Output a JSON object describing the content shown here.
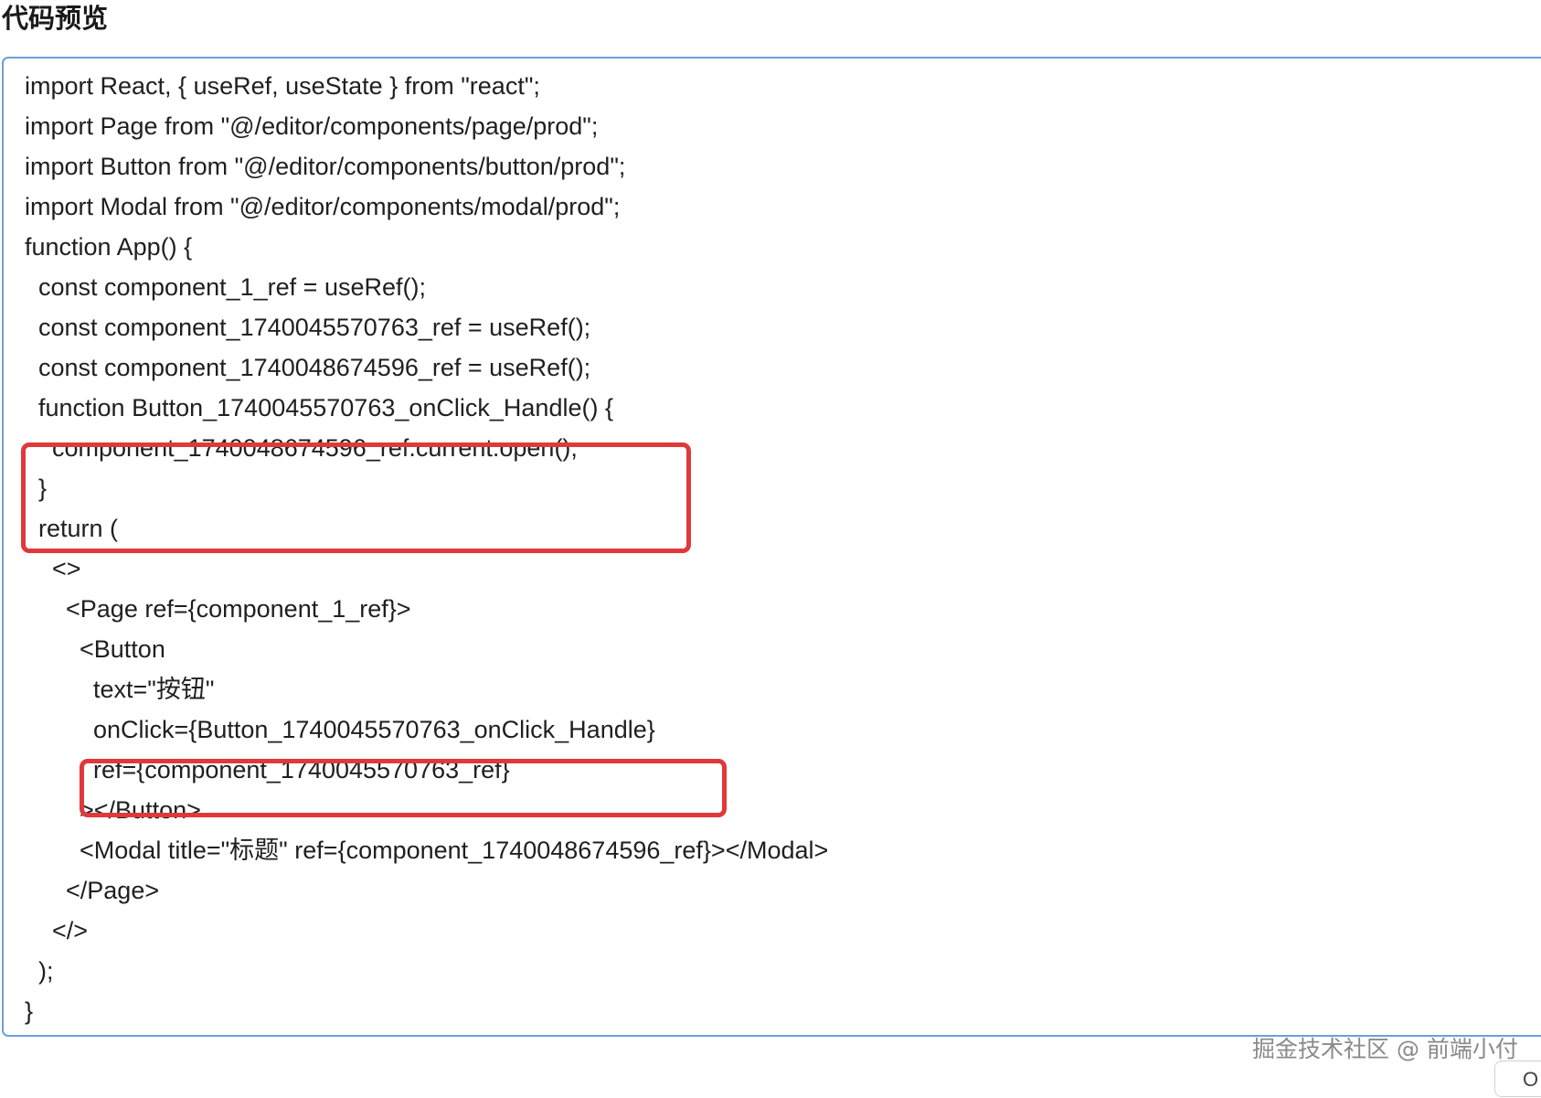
{
  "header": {
    "title": "代码预览"
  },
  "code_preview": {
    "lines": [
      "import React, { useRef, useState } from \"react\";",
      "import Page from \"@/editor/components/page/prod\";",
      "import Button from \"@/editor/components/button/prod\";",
      "import Modal from \"@/editor/components/modal/prod\";",
      "function App() {",
      "  const component_1_ref = useRef();",
      "  const component_1740045570763_ref = useRef();",
      "  const component_1740048674596_ref = useRef();",
      "  function Button_1740045570763_onClick_Handle() {",
      "    component_1740048674596_ref.current.open();",
      "  }",
      "  return (",
      "    <>",
      "      <Page ref={component_1_ref}>",
      "        <Button",
      "          text=\"按钮\"",
      "          onClick={Button_1740045570763_onClick_Handle}",
      "          ref={component_1740045570763_ref}",
      "        ></Button>",
      "        <Modal title=\"标题\" ref={component_1740048674596_ref}></Modal>",
      "      </Page>",
      "    </>",
      "  );",
      "}"
    ]
  },
  "watermark": {
    "text": "掘金技术社区 @ 前端小付"
  },
  "scroll_widget": {
    "text": "O"
  },
  "colors": {
    "code_border": "#6f9ed8",
    "highlight_border": "#e0393b",
    "text": "#1f1f1f",
    "watermark": "#8a8a8a"
  }
}
